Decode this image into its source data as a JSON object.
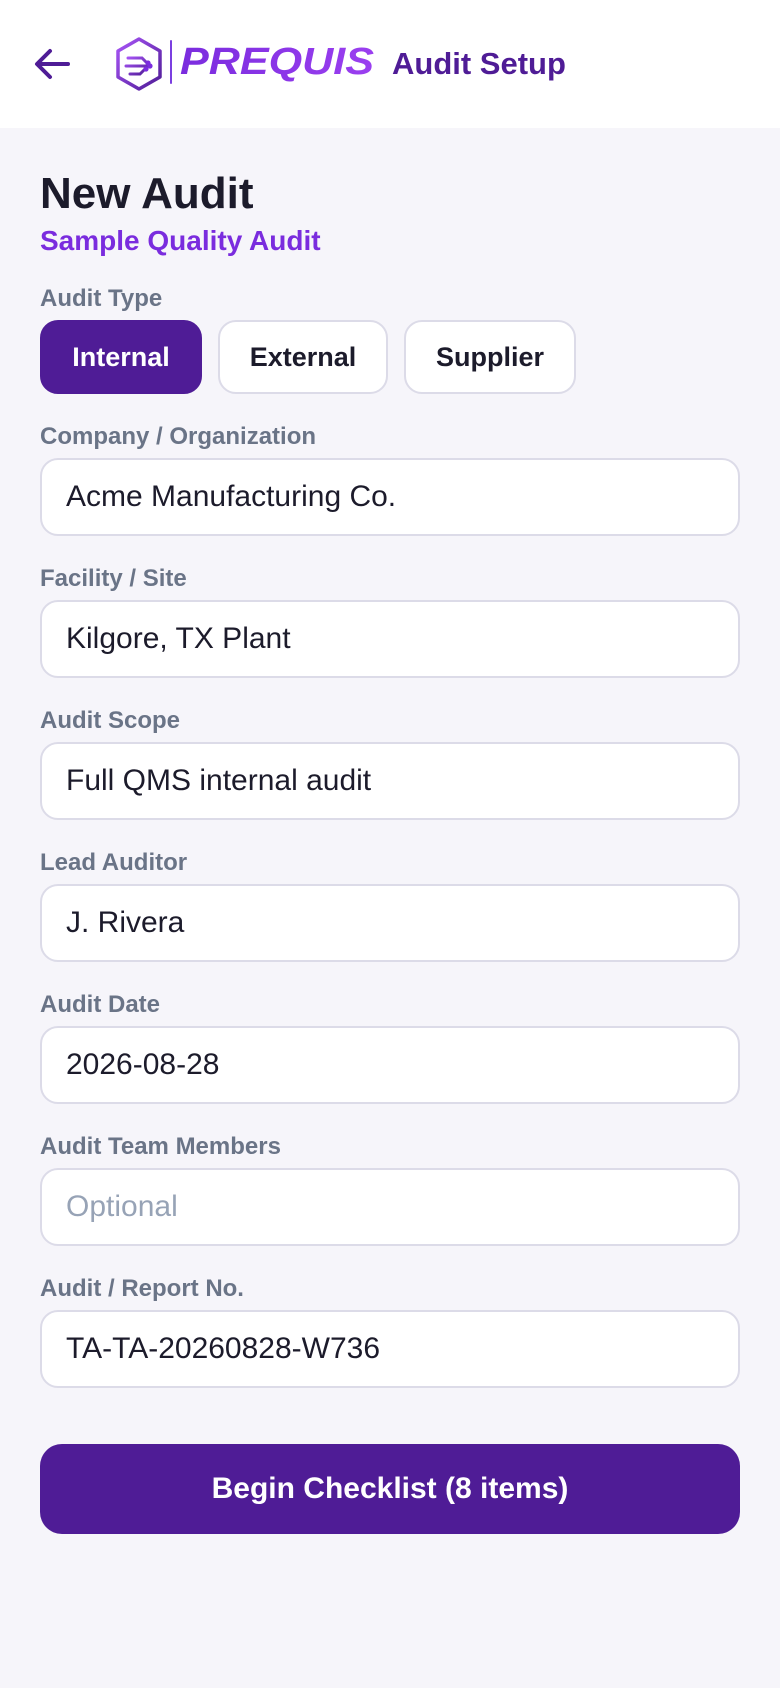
{
  "header": {
    "back_icon": "arrow-left-icon",
    "logo_text": "PREQUIS",
    "title": "Audit Setup"
  },
  "page": {
    "title": "New Audit",
    "subtitle": "Sample Quality Audit"
  },
  "audit_type": {
    "label": "Audit Type",
    "options": [
      "Internal",
      "External",
      "Supplier"
    ],
    "selected": "Internal"
  },
  "fields": {
    "company": {
      "label": "Company / Organization",
      "value": "Acme Manufacturing Co."
    },
    "facility": {
      "label": "Facility / Site",
      "value": "Kilgore, TX Plant"
    },
    "scope": {
      "label": "Audit Scope",
      "value": "Full QMS internal audit"
    },
    "lead_auditor": {
      "label": "Lead Auditor",
      "value": "J. Rivera"
    },
    "date": {
      "label": "Audit Date",
      "value": "2026-08-28"
    },
    "team": {
      "label": "Audit Team Members",
      "value": "",
      "placeholder": "Optional"
    },
    "report_no": {
      "label": "Audit / Report No.",
      "value": "TA-TA-20260828-W736"
    }
  },
  "actions": {
    "begin_label": "Begin Checklist (8 items)"
  },
  "colors": {
    "brand": "#4f1c96",
    "accent": "#7a2cde",
    "background": "#f6f5fa"
  }
}
